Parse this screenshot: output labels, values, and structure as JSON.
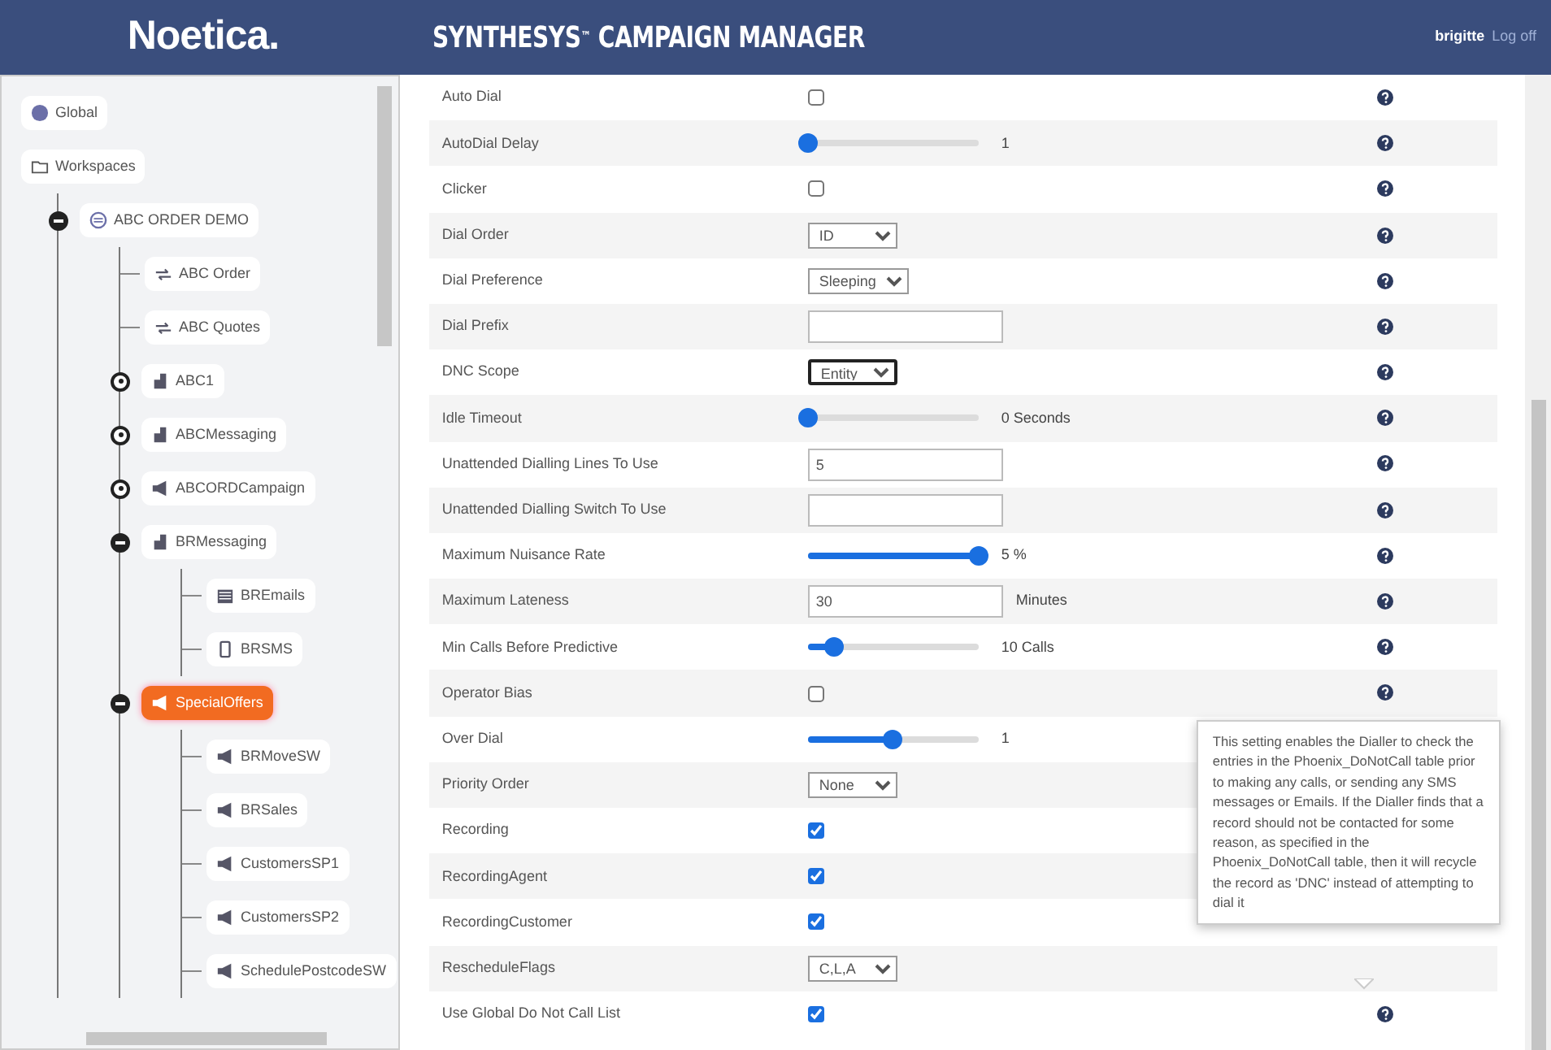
{
  "header": {
    "logo": "Noetica.",
    "title": "SYNTHESYS$^{™}$ CAMPAIGN MANAGER",
    "user": "brigitte",
    "logout": "Log off"
  },
  "tree": [
    {
      "label": "Global",
      "kind": "global",
      "selected": false
    },
    {
      "label": "Workspaces",
      "kind": "folder",
      "selected": false,
      "children": [
        {
          "label": "ABC ORDER DEMO",
          "kind": "workspace",
          "expanded": true,
          "selected": false,
          "children": [
            {
              "label": "ABC Order",
              "kind": "flow",
              "selected": false
            },
            {
              "label": "ABC Quotes",
              "kind": "flow",
              "selected": false
            },
            {
              "label": "ABC1",
              "kind": "building",
              "expanded": false,
              "selected": false
            },
            {
              "label": "ABCMessaging",
              "kind": "building",
              "expanded": false,
              "selected": false
            },
            {
              "label": "ABCORDCampaign",
              "kind": "megaphone",
              "expanded": false,
              "selected": false
            },
            {
              "label": "BRMessaging",
              "kind": "building",
              "expanded": true,
              "selected": false,
              "children": [
                {
                  "label": "BREmails",
                  "kind": "email",
                  "selected": false
                },
                {
                  "label": "BRSMS",
                  "kind": "sms",
                  "selected": false
                }
              ]
            },
            {
              "label": "SpecialOffers",
              "kind": "megaphone",
              "expanded": true,
              "selected": true,
              "children": [
                {
                  "label": "BRMoveSW",
                  "kind": "campaign",
                  "selected": false
                },
                {
                  "label": "BRSales",
                  "kind": "campaign",
                  "selected": false
                },
                {
                  "label": "CustomersSP1",
                  "kind": "campaign",
                  "selected": false
                },
                {
                  "label": "CustomersSP2",
                  "kind": "campaign",
                  "selected": false
                },
                {
                  "label": "SchedulePostcodeSW",
                  "kind": "campaign",
                  "selected": false
                }
              ]
            }
          ]
        }
      ]
    }
  ],
  "settings": [
    {
      "label": "Auto Dial",
      "kind": "checkbox",
      "checked": false,
      "help_icon": true
    },
    {
      "label": "AutoDial Delay",
      "kind": "slider",
      "level": 0,
      "reading": "1",
      "help_icon": true
    },
    {
      "label": "Clicker",
      "kind": "checkbox",
      "checked": false,
      "help_icon": true
    },
    {
      "label": "Dial Order",
      "kind": "select",
      "value": "ID",
      "focused": false,
      "help_icon": true
    },
    {
      "label": "Dial Preference",
      "kind": "select",
      "value": "Sleeping",
      "focused": false,
      "help_icon": true
    },
    {
      "label": "Dial Prefix",
      "kind": "text",
      "help_icon": true
    },
    {
      "label": "DNC Scope",
      "kind": "select",
      "value": "Entity",
      "focused": true,
      "help_icon": true
    },
    {
      "label": "Idle Timeout",
      "kind": "slider",
      "level": 0,
      "reading": "0 Seconds",
      "help_icon": true
    },
    {
      "label": "Unattended Dialling Lines To Use",
      "kind": "text",
      "value": "5",
      "help_icon": true
    },
    {
      "label": "Unattended Dialling Switch To Use",
      "kind": "text",
      "help_icon": true
    },
    {
      "label": "Maximum Nuisance Rate",
      "kind": "slider",
      "level": 1,
      "reading": "5 %",
      "help_icon": true
    },
    {
      "label": "Maximum Lateness",
      "kind": "text",
      "value": "30",
      "suffix": "Minutes",
      "help_icon": true
    },
    {
      "label": "Min Calls Before Predictive",
      "kind": "slider",
      "level": 0.15,
      "reading": "10 Calls",
      "help_icon": true
    },
    {
      "label": "Operator Bias",
      "kind": "checkbox",
      "checked": false,
      "help_icon": true
    },
    {
      "label": "Over Dial",
      "kind": "slider",
      "level": 0.5,
      "reading": "1",
      "help_icon": false
    },
    {
      "label": "Priority Order",
      "kind": "select",
      "value": "None",
      "focused": false,
      "help_icon": false
    },
    {
      "label": "Recording",
      "kind": "checkbox",
      "checked": true,
      "help_icon": false
    },
    {
      "label": "RecordingAgent",
      "kind": "checkbox",
      "checked": true,
      "help_icon": false
    },
    {
      "label": "RecordingCustomer",
      "kind": "checkbox",
      "checked": true,
      "help_icon": false
    },
    {
      "label": "RescheduleFlags",
      "kind": "select",
      "value": "C,L,A",
      "focused": false,
      "help_icon": false
    },
    {
      "label": "Use Global Do Not Call List",
      "kind": "checkbox",
      "checked": true,
      "help_icon": true
    }
  ],
  "tooltip": {
    "text": "This setting enables the Dialler to check the entries in the Phoenix_DoNotCall table prior to making any calls, or sending any SMS messages or Emails. If the Dialler finds that a record should not be contacted for some reason, as specified in the Phoenix_DoNotCall table, then it will recycle the record as 'DNC' instead of attempting to dial it"
  }
}
